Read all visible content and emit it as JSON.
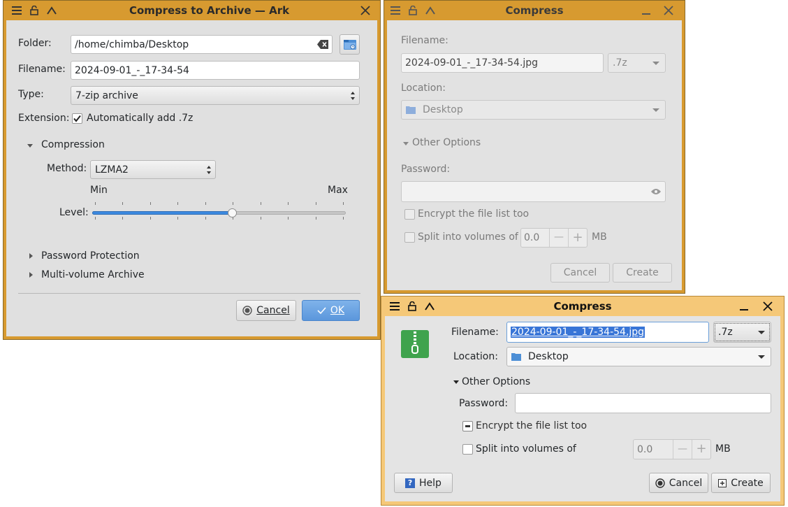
{
  "ark": {
    "title": "Compress to Archive — Ark",
    "folder_label": "Folder:",
    "folder_value": "/home/chimba/Desktop",
    "filename_label": "Filename:",
    "filename_value": "2024-09-01_-_17-34-54",
    "type_label": "Type:",
    "type_value": "7-zip archive",
    "extension_label": "Extension:",
    "extension_check_label": "Automatically add .7z",
    "compression_header": "Compression",
    "method_label": "Method:",
    "method_value": "LZMA2",
    "min_label": "Min",
    "max_label": "Max",
    "level_label": "Level:",
    "level_fraction": 0.55,
    "password_section": "Password Protection",
    "multivolume_section": "Multi-volume Archive",
    "cancel_label": "Cancel",
    "ok_label": "OK"
  },
  "compress_back": {
    "title": "Compress",
    "filename_label": "Filename:",
    "filename_value": "2024-09-01_-_17-34-54.jpg",
    "ext_value": ".7z",
    "location_label": "Location:",
    "location_value": "Desktop",
    "other_options": "Other Options",
    "password_label": "Password:",
    "encrypt_label": "Encrypt the file list too",
    "split_label": "Split into volumes of",
    "split_value": "0.0",
    "mb_label": "MB",
    "cancel_label": "Cancel",
    "create_label": "Create"
  },
  "compress_front": {
    "title": "Compress",
    "filename_label": "Filename:",
    "filename_value": "2024-09-01_-_17-34-54.jpg",
    "ext_value": ".7z",
    "location_label": "Location:",
    "location_value": "Desktop",
    "other_options": "Other Options",
    "password_label": "Password:",
    "encrypt_label": "Encrypt the file list too",
    "split_label": "Split into volumes of",
    "split_value": "0.0",
    "mb_label": "MB",
    "help_label": "Help",
    "cancel_label": "Cancel",
    "create_label": "Create"
  },
  "colors": {
    "frame": "#d79a30",
    "frame_active": "#f5c878",
    "accent": "#3d8ae0",
    "selection": "#3875d7",
    "archive_icon": "#3fa34d"
  }
}
